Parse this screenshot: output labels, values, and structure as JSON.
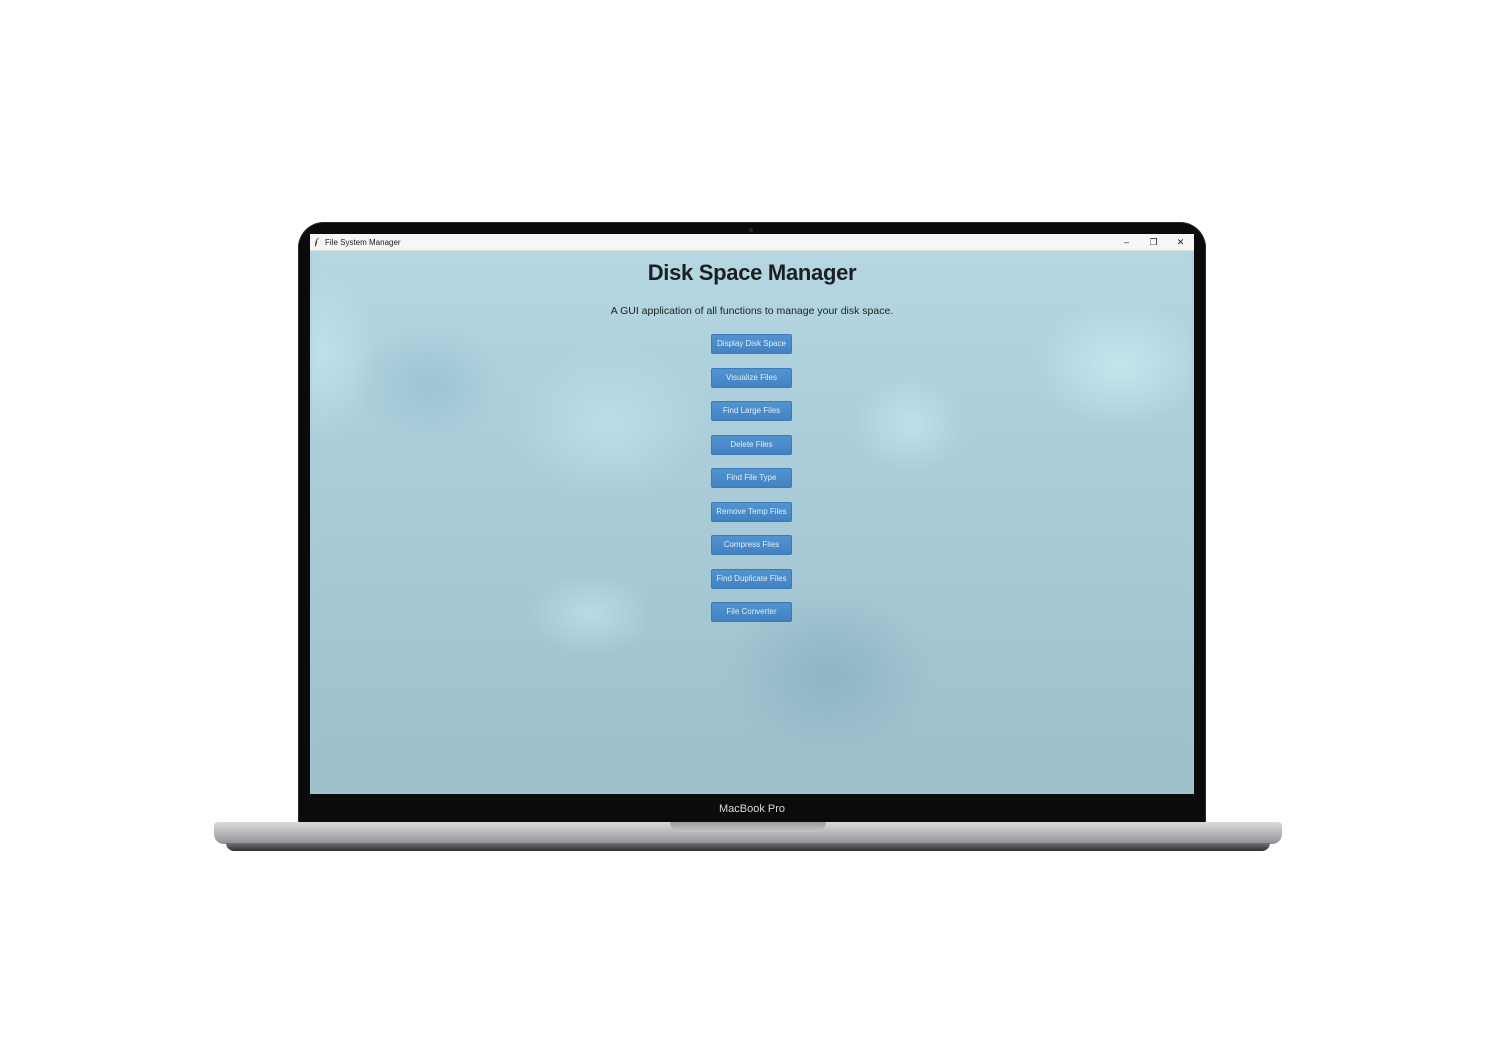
{
  "device": {
    "label": "MacBook Pro"
  },
  "window": {
    "title": "File System Manager",
    "controls": {
      "minimize": "–",
      "maximize": "❐",
      "close": "✕"
    }
  },
  "app": {
    "heading": "Disk Space Manager",
    "subtitle": "A GUI application of all functions to manage your disk space.",
    "buttons": [
      {
        "label": "Display Disk Space"
      },
      {
        "label": "Visualize Files"
      },
      {
        "label": "Find Large Files"
      },
      {
        "label": "Delete Files"
      },
      {
        "label": "Find File Type"
      },
      {
        "label": "Remove Temp Files"
      },
      {
        "label": "Compress Files"
      },
      {
        "label": "Find Duplicate Files"
      },
      {
        "label": "File Converter"
      }
    ]
  },
  "icons": {
    "app": "feather-icon",
    "minimize": "minimize-icon",
    "maximize": "maximize-icon",
    "close": "close-icon"
  },
  "colors": {
    "button": "#3a7cc0",
    "button_text": "#e6f0fa",
    "background": "#a8cad6"
  }
}
